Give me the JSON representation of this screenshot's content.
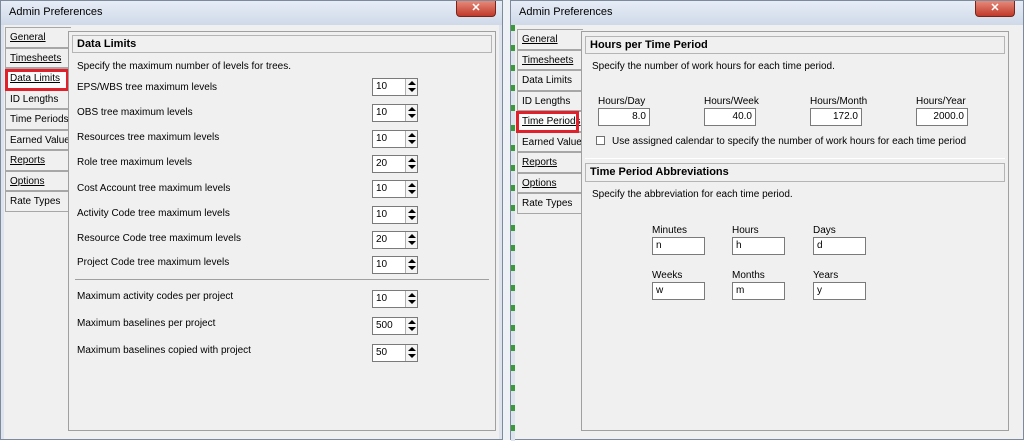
{
  "left": {
    "title": "Admin Preferences",
    "close": "✕",
    "tabs": [
      "General",
      "Timesheets",
      "Data Limits",
      "ID Lengths",
      "Time Periods",
      "Earned Value",
      "Reports",
      "Options",
      "Rate Types"
    ],
    "group_title": "Data Limits",
    "desc": "Specify the maximum number of levels for trees.",
    "rows": [
      {
        "label": "EPS/WBS tree maximum levels",
        "value": "10"
      },
      {
        "label": "OBS tree maximum levels",
        "value": "10"
      },
      {
        "label": "Resources tree maximum levels",
        "value": "10"
      },
      {
        "label": "Role tree maximum levels",
        "value": "20"
      },
      {
        "label": "Cost Account tree maximum levels",
        "value": "10"
      },
      {
        "label": "Activity Code tree maximum levels",
        "value": "10"
      },
      {
        "label": "Resource Code tree maximum levels",
        "value": "20"
      },
      {
        "label": "Project Code tree maximum levels",
        "value": "10"
      },
      {
        "label": "Maximum activity codes per project",
        "value": "10"
      },
      {
        "label": "Maximum baselines per project",
        "value": "500"
      },
      {
        "label": "Maximum baselines copied with project",
        "value": "50"
      }
    ]
  },
  "right": {
    "title": "Admin Preferences",
    "close": "✕",
    "tabs": [
      "General",
      "Timesheets",
      "Data Limits",
      "ID Lengths",
      "Time Periods",
      "Earned Value",
      "Reports",
      "Options",
      "Rate Types"
    ],
    "hours_title": "Hours per Time Period",
    "hours_desc": "Specify the number of work hours for each time period.",
    "hours": [
      {
        "label": "Hours/Day",
        "value": "8.0"
      },
      {
        "label": "Hours/Week",
        "value": "40.0"
      },
      {
        "label": "Hours/Month",
        "value": "172.0"
      },
      {
        "label": "Hours/Year",
        "value": "2000.0"
      }
    ],
    "calendar_check": "Use assigned calendar to specify the number of work hours for each time period",
    "abbr_title": "Time Period Abbreviations",
    "abbr_desc": "Specify the abbreviation for each time period.",
    "abbr": [
      {
        "label": "Minutes",
        "value": "n"
      },
      {
        "label": "Hours",
        "value": "h"
      },
      {
        "label": "Days",
        "value": "d"
      },
      {
        "label": "Weeks",
        "value": "w"
      },
      {
        "label": "Months",
        "value": "m"
      },
      {
        "label": "Years",
        "value": "y"
      }
    ]
  }
}
